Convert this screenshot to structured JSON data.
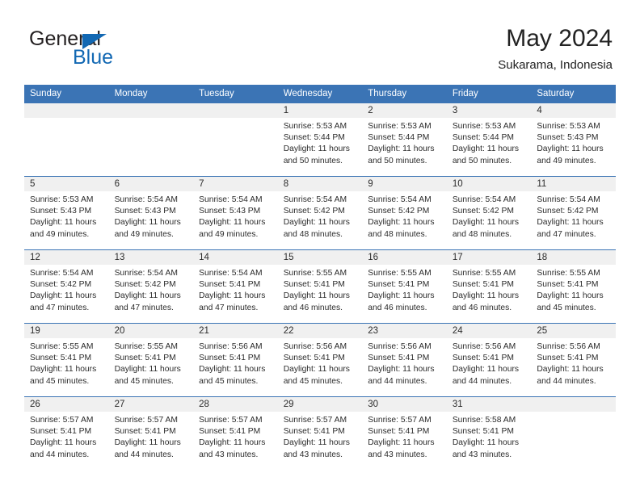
{
  "brand": {
    "name_top": "General",
    "name_bottom": "Blue",
    "accent_color": "#1268b3",
    "triangle_icon": "triangle-icon"
  },
  "header": {
    "title": "May 2024",
    "subtitle": "Sukarama, Indonesia"
  },
  "theme": {
    "header_bg": "#3b74b5",
    "daynum_bg": "#f0f0f0",
    "row_rule": "#3b74b5",
    "text": "#2b2b2b"
  },
  "weekday_headers": [
    "Sunday",
    "Monday",
    "Tuesday",
    "Wednesday",
    "Thursday",
    "Friday",
    "Saturday"
  ],
  "weeks": [
    [
      {
        "day": ""
      },
      {
        "day": ""
      },
      {
        "day": ""
      },
      {
        "day": "1",
        "sunrise": "Sunrise: 5:53 AM",
        "sunset": "Sunset: 5:44 PM",
        "daylight_l1": "Daylight: 11 hours",
        "daylight_l2": "and 50 minutes."
      },
      {
        "day": "2",
        "sunrise": "Sunrise: 5:53 AM",
        "sunset": "Sunset: 5:44 PM",
        "daylight_l1": "Daylight: 11 hours",
        "daylight_l2": "and 50 minutes."
      },
      {
        "day": "3",
        "sunrise": "Sunrise: 5:53 AM",
        "sunset": "Sunset: 5:44 PM",
        "daylight_l1": "Daylight: 11 hours",
        "daylight_l2": "and 50 minutes."
      },
      {
        "day": "4",
        "sunrise": "Sunrise: 5:53 AM",
        "sunset": "Sunset: 5:43 PM",
        "daylight_l1": "Daylight: 11 hours",
        "daylight_l2": "and 49 minutes."
      }
    ],
    [
      {
        "day": "5",
        "sunrise": "Sunrise: 5:53 AM",
        "sunset": "Sunset: 5:43 PM",
        "daylight_l1": "Daylight: 11 hours",
        "daylight_l2": "and 49 minutes."
      },
      {
        "day": "6",
        "sunrise": "Sunrise: 5:54 AM",
        "sunset": "Sunset: 5:43 PM",
        "daylight_l1": "Daylight: 11 hours",
        "daylight_l2": "and 49 minutes."
      },
      {
        "day": "7",
        "sunrise": "Sunrise: 5:54 AM",
        "sunset": "Sunset: 5:43 PM",
        "daylight_l1": "Daylight: 11 hours",
        "daylight_l2": "and 49 minutes."
      },
      {
        "day": "8",
        "sunrise": "Sunrise: 5:54 AM",
        "sunset": "Sunset: 5:42 PM",
        "daylight_l1": "Daylight: 11 hours",
        "daylight_l2": "and 48 minutes."
      },
      {
        "day": "9",
        "sunrise": "Sunrise: 5:54 AM",
        "sunset": "Sunset: 5:42 PM",
        "daylight_l1": "Daylight: 11 hours",
        "daylight_l2": "and 48 minutes."
      },
      {
        "day": "10",
        "sunrise": "Sunrise: 5:54 AM",
        "sunset": "Sunset: 5:42 PM",
        "daylight_l1": "Daylight: 11 hours",
        "daylight_l2": "and 48 minutes."
      },
      {
        "day": "11",
        "sunrise": "Sunrise: 5:54 AM",
        "sunset": "Sunset: 5:42 PM",
        "daylight_l1": "Daylight: 11 hours",
        "daylight_l2": "and 47 minutes."
      }
    ],
    [
      {
        "day": "12",
        "sunrise": "Sunrise: 5:54 AM",
        "sunset": "Sunset: 5:42 PM",
        "daylight_l1": "Daylight: 11 hours",
        "daylight_l2": "and 47 minutes."
      },
      {
        "day": "13",
        "sunrise": "Sunrise: 5:54 AM",
        "sunset": "Sunset: 5:42 PM",
        "daylight_l1": "Daylight: 11 hours",
        "daylight_l2": "and 47 minutes."
      },
      {
        "day": "14",
        "sunrise": "Sunrise: 5:54 AM",
        "sunset": "Sunset: 5:41 PM",
        "daylight_l1": "Daylight: 11 hours",
        "daylight_l2": "and 47 minutes."
      },
      {
        "day": "15",
        "sunrise": "Sunrise: 5:55 AM",
        "sunset": "Sunset: 5:41 PM",
        "daylight_l1": "Daylight: 11 hours",
        "daylight_l2": "and 46 minutes."
      },
      {
        "day": "16",
        "sunrise": "Sunrise: 5:55 AM",
        "sunset": "Sunset: 5:41 PM",
        "daylight_l1": "Daylight: 11 hours",
        "daylight_l2": "and 46 minutes."
      },
      {
        "day": "17",
        "sunrise": "Sunrise: 5:55 AM",
        "sunset": "Sunset: 5:41 PM",
        "daylight_l1": "Daylight: 11 hours",
        "daylight_l2": "and 46 minutes."
      },
      {
        "day": "18",
        "sunrise": "Sunrise: 5:55 AM",
        "sunset": "Sunset: 5:41 PM",
        "daylight_l1": "Daylight: 11 hours",
        "daylight_l2": "and 45 minutes."
      }
    ],
    [
      {
        "day": "19",
        "sunrise": "Sunrise: 5:55 AM",
        "sunset": "Sunset: 5:41 PM",
        "daylight_l1": "Daylight: 11 hours",
        "daylight_l2": "and 45 minutes."
      },
      {
        "day": "20",
        "sunrise": "Sunrise: 5:55 AM",
        "sunset": "Sunset: 5:41 PM",
        "daylight_l1": "Daylight: 11 hours",
        "daylight_l2": "and 45 minutes."
      },
      {
        "day": "21",
        "sunrise": "Sunrise: 5:56 AM",
        "sunset": "Sunset: 5:41 PM",
        "daylight_l1": "Daylight: 11 hours",
        "daylight_l2": "and 45 minutes."
      },
      {
        "day": "22",
        "sunrise": "Sunrise: 5:56 AM",
        "sunset": "Sunset: 5:41 PM",
        "daylight_l1": "Daylight: 11 hours",
        "daylight_l2": "and 45 minutes."
      },
      {
        "day": "23",
        "sunrise": "Sunrise: 5:56 AM",
        "sunset": "Sunset: 5:41 PM",
        "daylight_l1": "Daylight: 11 hours",
        "daylight_l2": "and 44 minutes."
      },
      {
        "day": "24",
        "sunrise": "Sunrise: 5:56 AM",
        "sunset": "Sunset: 5:41 PM",
        "daylight_l1": "Daylight: 11 hours",
        "daylight_l2": "and 44 minutes."
      },
      {
        "day": "25",
        "sunrise": "Sunrise: 5:56 AM",
        "sunset": "Sunset: 5:41 PM",
        "daylight_l1": "Daylight: 11 hours",
        "daylight_l2": "and 44 minutes."
      }
    ],
    [
      {
        "day": "26",
        "sunrise": "Sunrise: 5:57 AM",
        "sunset": "Sunset: 5:41 PM",
        "daylight_l1": "Daylight: 11 hours",
        "daylight_l2": "and 44 minutes."
      },
      {
        "day": "27",
        "sunrise": "Sunrise: 5:57 AM",
        "sunset": "Sunset: 5:41 PM",
        "daylight_l1": "Daylight: 11 hours",
        "daylight_l2": "and 44 minutes."
      },
      {
        "day": "28",
        "sunrise": "Sunrise: 5:57 AM",
        "sunset": "Sunset: 5:41 PM",
        "daylight_l1": "Daylight: 11 hours",
        "daylight_l2": "and 43 minutes."
      },
      {
        "day": "29",
        "sunrise": "Sunrise: 5:57 AM",
        "sunset": "Sunset: 5:41 PM",
        "daylight_l1": "Daylight: 11 hours",
        "daylight_l2": "and 43 minutes."
      },
      {
        "day": "30",
        "sunrise": "Sunrise: 5:57 AM",
        "sunset": "Sunset: 5:41 PM",
        "daylight_l1": "Daylight: 11 hours",
        "daylight_l2": "and 43 minutes."
      },
      {
        "day": "31",
        "sunrise": "Sunrise: 5:58 AM",
        "sunset": "Sunset: 5:41 PM",
        "daylight_l1": "Daylight: 11 hours",
        "daylight_l2": "and 43 minutes."
      },
      {
        "day": ""
      }
    ]
  ]
}
